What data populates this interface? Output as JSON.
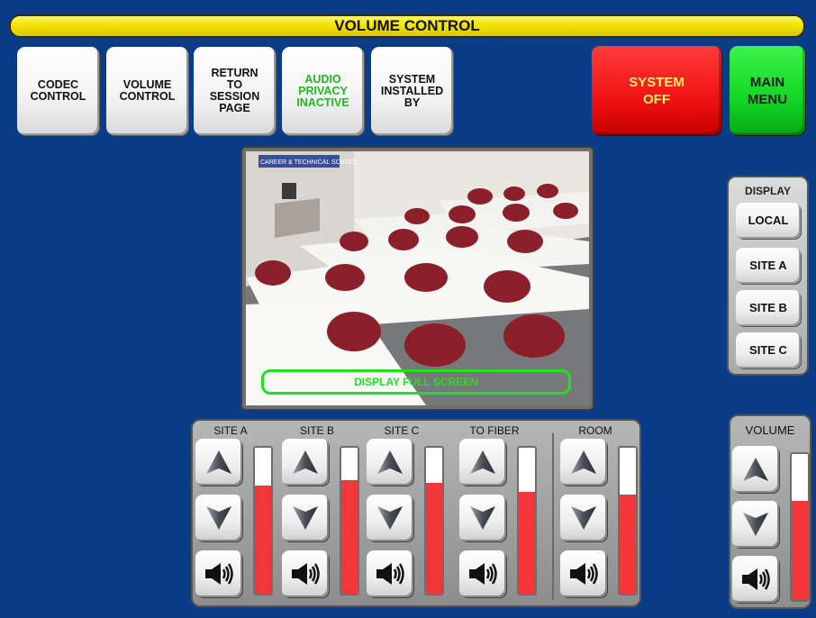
{
  "title": "VOLUME CONTROL",
  "top_buttons": [
    {
      "label": "CODEC\nCONTROL"
    },
    {
      "label": "VOLUME\nCONTROL"
    },
    {
      "label": "RETURN\nTO\nSESSION\nPAGE"
    },
    {
      "label": "AUDIO\nPRIVACY\nINACTIVE"
    },
    {
      "label": "SYSTEM\nINSTALLED\nBY"
    }
  ],
  "system_off_label": "SYSTEM\nOFF",
  "main_menu_label": "MAIN\nMENU",
  "video": {
    "sign_text": "CAREER & TECHNICAL SCHOOL",
    "fullscreen_label": "DISPLAY FULL SCREEN"
  },
  "display_panel": {
    "title": "DISPLAY",
    "buttons": [
      "LOCAL",
      "SITE A",
      "SITE B",
      "SITE C"
    ]
  },
  "channels": [
    {
      "label": "SITE A",
      "level_percent": 74
    },
    {
      "label": "SITE B",
      "level_percent": 78
    },
    {
      "label": "SITE C",
      "level_percent": 76
    },
    {
      "label": "TO FIBER",
      "level_percent": 70
    },
    {
      "label": "ROOM",
      "level_percent": 68
    }
  ],
  "volume": {
    "label": "VOLUME",
    "level_percent": 68
  },
  "colors": {
    "background": "#0a3d86",
    "title_bar": "#f1e400",
    "system_off": "#f01212",
    "main_menu": "#12d624",
    "meter_fill": "#f2363a",
    "privacy_text": "#25b523",
    "fullscreen_outline": "#20e022"
  },
  "icons": [
    "up-arrow-icon",
    "down-arrow-icon",
    "speaker-mute-icon"
  ]
}
